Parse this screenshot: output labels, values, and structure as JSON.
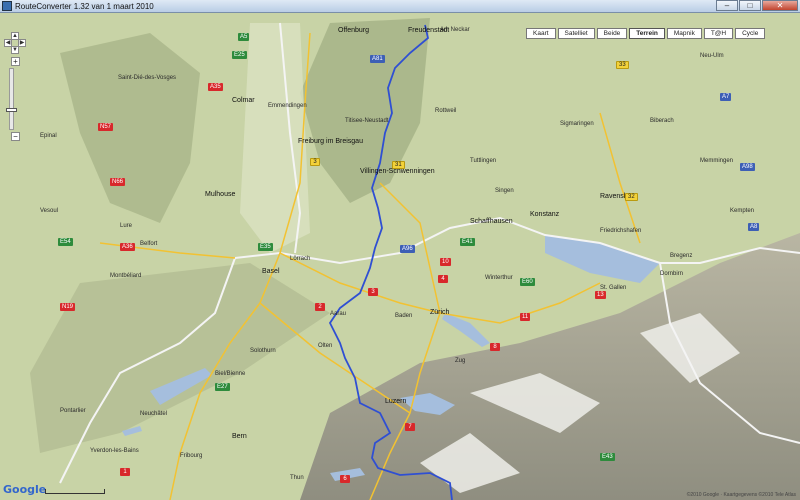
{
  "window": {
    "title": "RouteConverter 1.32 van 1 maart 2010",
    "controls": {
      "minimize": "–",
      "maximize": "□",
      "close": "✕"
    }
  },
  "map_type_buttons": [
    {
      "label": "Kaart",
      "active": false
    },
    {
      "label": "Satelliet",
      "active": false
    },
    {
      "label": "Beide",
      "active": false
    },
    {
      "label": "Terrein",
      "active": true
    },
    {
      "label": "Mapnik",
      "active": false
    },
    {
      "label": "T@H",
      "active": false
    },
    {
      "label": "Cycle",
      "active": false
    }
  ],
  "navigation": {
    "pan_up": "▲",
    "pan_left": "◀",
    "pan_right": "▶",
    "pan_down": "▼",
    "zoom_in": "+",
    "zoom_out": "−"
  },
  "places": [
    {
      "name": "Offenburg",
      "big": true
    },
    {
      "name": "Freudenstadt",
      "big": true
    },
    {
      "name": "Am Neckar",
      "big": false
    },
    {
      "name": "Saint-Dié-des-Vosges",
      "big": false
    },
    {
      "name": "Colmar",
      "big": true
    },
    {
      "name": "Freiburg im Breisgau",
      "big": true
    },
    {
      "name": "Villingen-Schwenningen",
      "big": true
    },
    {
      "name": "Mulhouse",
      "big": true
    },
    {
      "name": "Basel",
      "big": true
    },
    {
      "name": "Schaffhausen",
      "big": true
    },
    {
      "name": "Konstanz",
      "big": true
    },
    {
      "name": "Ravensburg",
      "big": true
    },
    {
      "name": "Neu-Ulm",
      "big": false
    },
    {
      "name": "Memmingen",
      "big": false
    },
    {
      "name": "Kempten",
      "big": false
    },
    {
      "name": "Zürich",
      "big": true
    },
    {
      "name": "Bern",
      "big": true
    },
    {
      "name": "Luzern",
      "big": true
    },
    {
      "name": "Belfort",
      "big": false
    },
    {
      "name": "Epinal",
      "big": false
    },
    {
      "name": "Dornbirn",
      "big": false
    },
    {
      "name": "Biel/Bienne",
      "big": false
    },
    {
      "name": "Neuchâtel",
      "big": false
    },
    {
      "name": "Thun",
      "big": false
    },
    {
      "name": "Winterthur",
      "big": false
    },
    {
      "name": "St. Gallen",
      "big": false
    },
    {
      "name": "Bregenz",
      "big": false
    },
    {
      "name": "Aarau",
      "big": false
    },
    {
      "name": "Olten",
      "big": false
    },
    {
      "name": "Solothurn",
      "big": false
    },
    {
      "name": "Lörrach",
      "big": false
    },
    {
      "name": "Montbéliard",
      "big": false
    },
    {
      "name": "Lure",
      "big": false
    },
    {
      "name": "Vesoul",
      "big": false
    },
    {
      "name": "Emmendingen",
      "big": false
    },
    {
      "name": "Titisee-Neustadt",
      "big": false
    },
    {
      "name": "Rottweil",
      "big": false
    },
    {
      "name": "Tuttlingen",
      "big": false
    },
    {
      "name": "Singen",
      "big": false
    },
    {
      "name": "Sigmaringen",
      "big": false
    },
    {
      "name": "Biberach",
      "big": false
    },
    {
      "name": "Friedrichshafen",
      "big": false
    },
    {
      "name": "Zug",
      "big": false
    },
    {
      "name": "Baden",
      "big": false
    },
    {
      "name": "Pontarlier",
      "big": false
    },
    {
      "name": "Yverdon-les-Bains",
      "big": false
    },
    {
      "name": "Fribourg",
      "big": false
    }
  ],
  "road_shields": [
    {
      "label": "A5",
      "color": "green"
    },
    {
      "label": "A35",
      "color": "red"
    },
    {
      "label": "A36",
      "color": "red"
    },
    {
      "label": "E25",
      "color": "green"
    },
    {
      "label": "E35",
      "color": "green"
    },
    {
      "label": "E54",
      "color": "green"
    },
    {
      "label": "E60",
      "color": "green"
    },
    {
      "label": "E41",
      "color": "green"
    },
    {
      "label": "E43",
      "color": "green"
    },
    {
      "label": "E27",
      "color": "green"
    },
    {
      "label": "31",
      "color": "yellow"
    },
    {
      "label": "33",
      "color": "yellow"
    },
    {
      "label": "32",
      "color": "yellow"
    },
    {
      "label": "3",
      "color": "yellow"
    },
    {
      "label": "N57",
      "color": "red"
    },
    {
      "label": "N66",
      "color": "red"
    },
    {
      "label": "N19",
      "color": "red"
    },
    {
      "label": "1",
      "color": "red"
    },
    {
      "label": "2",
      "color": "red"
    },
    {
      "label": "3",
      "color": "red"
    },
    {
      "label": "4",
      "color": "red"
    },
    {
      "label": "6",
      "color": "red"
    },
    {
      "label": "7",
      "color": "red"
    },
    {
      "label": "8",
      "color": "red"
    },
    {
      "label": "10",
      "color": "red"
    },
    {
      "label": "11",
      "color": "red"
    },
    {
      "label": "13",
      "color": "red"
    },
    {
      "label": "A81",
      "color": "blue"
    },
    {
      "label": "A96",
      "color": "blue"
    },
    {
      "label": "A7",
      "color": "blue"
    },
    {
      "label": "A98",
      "color": "blue"
    },
    {
      "label": "A8",
      "color": "blue"
    }
  ],
  "route": {
    "color": "#2f4fd3"
  },
  "attribution": {
    "logo": "Google",
    "copyright": "©2010 Google · Kaartgegevens ©2010 Tele Atlas"
  }
}
